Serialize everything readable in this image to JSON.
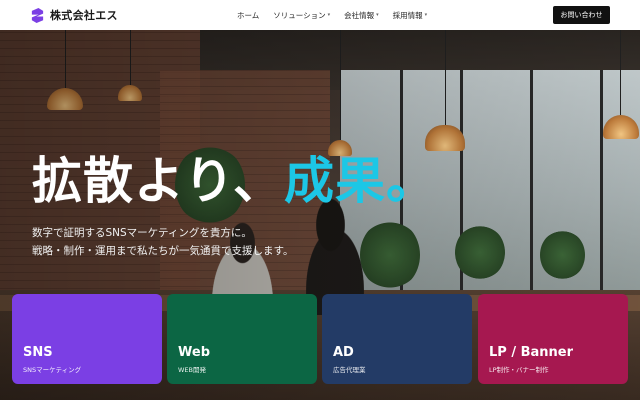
{
  "brand": {
    "name": "株式会社エス",
    "logo_icon": "s-logo-icon",
    "logo_color": "#7b3fe4"
  },
  "nav": {
    "items": [
      {
        "label": "ホーム",
        "has_dropdown": false
      },
      {
        "label": "ソリューション",
        "has_dropdown": true
      },
      {
        "label": "会社情報",
        "has_dropdown": true
      },
      {
        "label": "採用情報",
        "has_dropdown": true
      }
    ],
    "caret": "▾",
    "contact_label": "お問い合わせ"
  },
  "hero": {
    "headline_main": "拡散より、",
    "headline_accent": "成果。",
    "accent_color": "#1cc7e6",
    "subcopy_line1": "数字で証明するSNSマーケティングを貴方に。",
    "subcopy_line2": "戦略・制作・運用まで私たちが一気通貫で支援します。"
  },
  "cards": [
    {
      "title": "SNS",
      "subtitle": "SNSマーケティング",
      "color": "#7b3fe4"
    },
    {
      "title": "Web",
      "subtitle": "WEB開発",
      "color": "#0c6644"
    },
    {
      "title": "AD",
      "subtitle": "広告代理業",
      "color": "#233b66"
    },
    {
      "title": "LP / Banner",
      "subtitle": "LP制作・バナー制作",
      "color": "#a61850"
    }
  ]
}
